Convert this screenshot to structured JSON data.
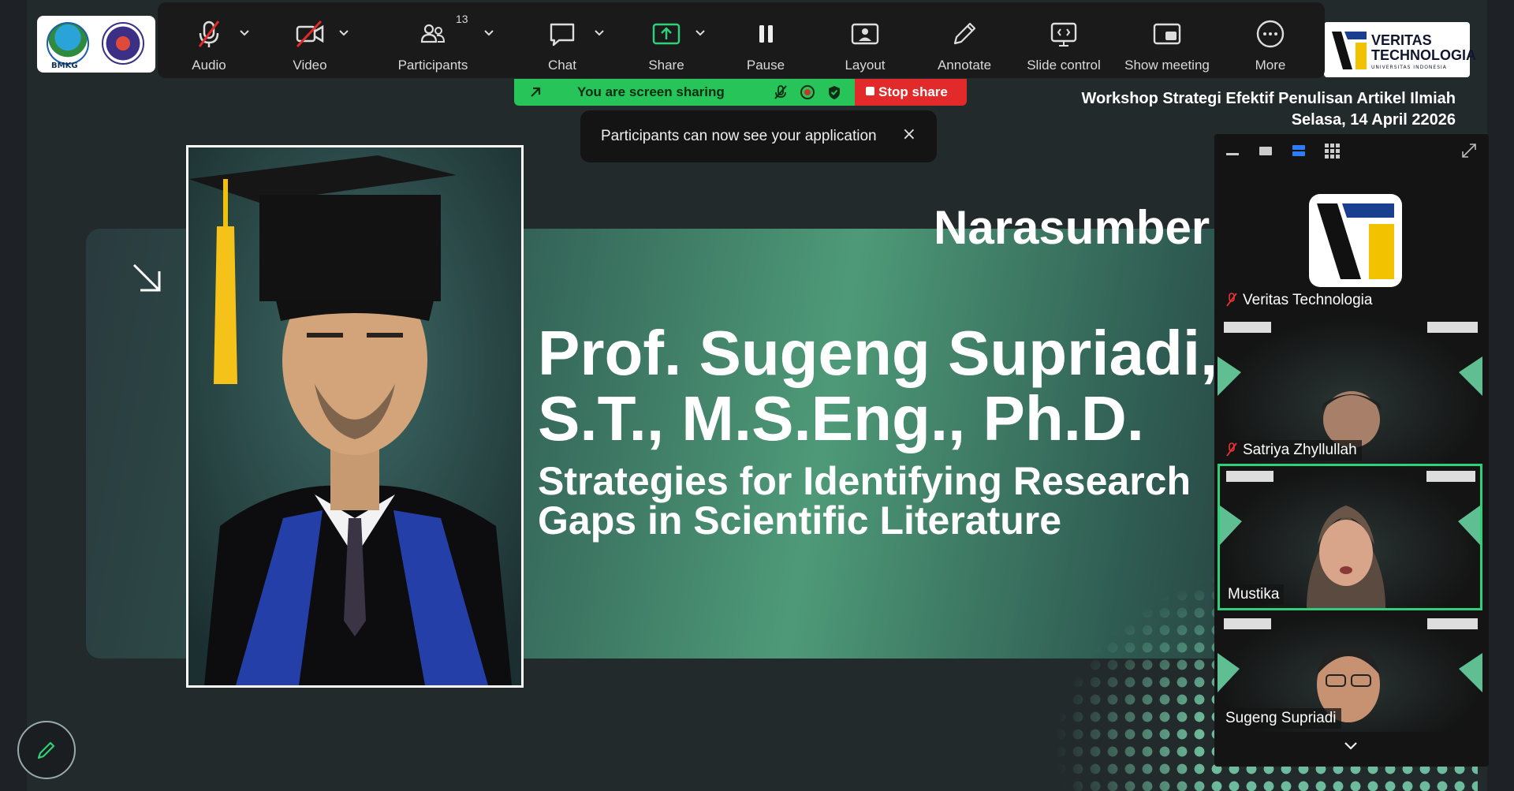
{
  "toolbar": {
    "items": [
      {
        "label": "Audio",
        "icon": "microphone-muted-icon"
      },
      {
        "label": "Video",
        "icon": "video-off-icon"
      },
      {
        "label": "Participants",
        "icon": "participants-icon",
        "count": "13"
      },
      {
        "label": "Chat",
        "icon": "chat-icon"
      },
      {
        "label": "Share",
        "icon": "share-screen-icon"
      },
      {
        "label": "Pause",
        "icon": "pause-icon"
      },
      {
        "label": "Layout",
        "icon": "layout-icon"
      },
      {
        "label": "Annotate",
        "icon": "pencil-icon"
      },
      {
        "label": "Slide control",
        "icon": "slide-control-icon"
      },
      {
        "label": "Show meeting",
        "icon": "show-meeting-icon"
      },
      {
        "label": "More",
        "icon": "more-icon"
      }
    ]
  },
  "sharing": {
    "status": "You are screen sharing",
    "stop_label": "Stop share",
    "color_sharing": "#27c45a",
    "color_stop": "#e22a2a"
  },
  "toast": {
    "message": "Participants can now see your application",
    "close": "×"
  },
  "slide": {
    "left_logo_text": "BMKG",
    "right_logo_line1": "VERITAS",
    "right_logo_line2": "TECHNOLOGIA",
    "right_logo_sub": "UNIVERSITAS INDONESIA",
    "workshop_title": "Workshop Strategi Efektif Penulisan Artikel Ilmiah",
    "workshop_date": "Selasa, 14 April 22026",
    "heading": "Narasumber",
    "speaker_line1": "Prof. Sugeng Supriadi,",
    "speaker_line2": "S.T., M.S.Eng., Ph.D.",
    "topic_line1": "Strategies for Identifying Research",
    "topic_line2": "Gaps in Scientific Literature"
  },
  "gallery": {
    "participants": [
      {
        "name": "Veritas Technologia",
        "muted": true
      },
      {
        "name": "Satriya Zhyllullah",
        "muted": true
      },
      {
        "name": "Mustika",
        "muted": false,
        "active_speaker": true
      },
      {
        "name": "Sugeng Supriadi",
        "muted": false
      }
    ]
  }
}
